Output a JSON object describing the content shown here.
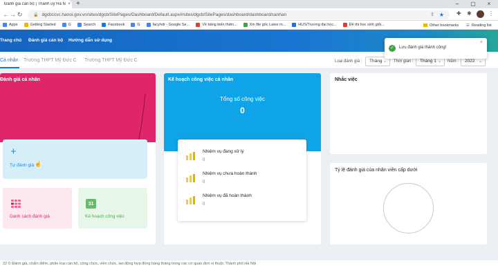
{
  "browser": {
    "tab_title": "Đánh giá cán bộ | Thành uỷ Hà N",
    "url": "dgcbccvc.hanoi.gov.vn/sites/dgcb/SitePages/Dashboard/Default.aspx#/sites/dgcb/SitePages/dashboard/dashboard/canhan",
    "bookmarks": [
      "Apps",
      "Getting Started",
      "G",
      "Search",
      "Facebook",
      "G",
      "facyhdr - Google Se...",
      "Về bảng biến thiên...",
      "Xin file gốc Latex m...",
      "HUS/Trương đại học...",
      "Đề thi học sinh giỏi..."
    ],
    "other_bookmarks": "Other bookmarks",
    "reading_list": "Reading list"
  },
  "app": {
    "menu": [
      "Trang chủ",
      "Đánh giá cán bộ",
      "Hướng dẫn sử dụng"
    ]
  },
  "subnav": {
    "tabs": [
      "Cá nhân",
      "Trường THPT Mỹ Đức C",
      "Trường THPT Mỹ Đức C"
    ],
    "filter_type_label": "Loại đánh giá :",
    "filter_type_value": "Tháng",
    "filter_time_label": "Thời gian :",
    "filter_time_value": "Tháng 1",
    "filter_year_label": "Năm :",
    "filter_year_value": "2022"
  },
  "toast": {
    "message": "Lưu đánh giá thành công!"
  },
  "cards": {
    "self_eval_title": "Đánh giá cá nhân",
    "self_eval_action": "Tự đánh giá",
    "eval_list": "Danh sách đánh giá",
    "work_plan_tile": "Kế hoạch công việc",
    "calendar_day": "31",
    "plan_title": "Kế hoạch công việc cá nhân",
    "total_label": "Tổng số công việc",
    "total_value": "0",
    "tasks": [
      {
        "label": "Nhiệm vụ đang xử lý",
        "count": "0"
      },
      {
        "label": "Nhiệm vụ chưa hoàn thành",
        "count": "0"
      },
      {
        "label": "Nhiệm vụ đã hoàn thành",
        "count": "0"
      }
    ],
    "reminder_title": "Nhắc việc",
    "ratio_title": "Tỷ lệ đánh giá của nhân viên cấp dưới"
  },
  "footer": {
    "text": "22 © Đánh giá, chấm điểm, phân loại cán bộ, công chức, viên chức, lao động hợp đồng hàng tháng trong các cơ quan đơn vị thuộc Thành phố Hà Nội"
  },
  "colors": {
    "pink": "#e0266a",
    "blue": "#0fa4e8",
    "accent": "#1976d2",
    "success": "#43a047"
  }
}
